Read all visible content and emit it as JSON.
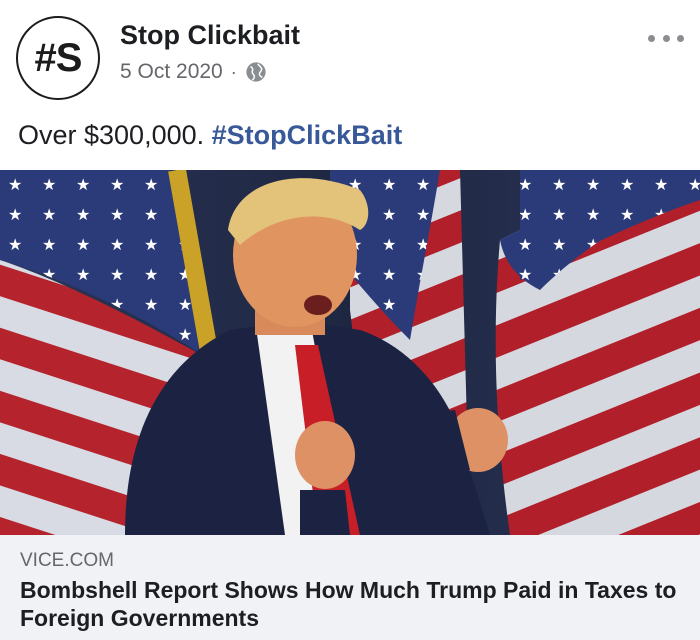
{
  "post": {
    "page_name": "Stop Clickbait",
    "avatar_text": "#S",
    "date": "5 Oct 2020",
    "separator": "·",
    "privacy_icon": "globe-icon",
    "more_icon": "more-options-icon",
    "text_prefix": "Over $300,000.",
    "hashtag": "#StopClickBait"
  },
  "link_preview": {
    "domain": "VICE.COM",
    "headline": "Bombshell Report Shows How Much Trump Paid in Taxes to Foreign Governments"
  },
  "colors": {
    "hashtag": "#385898",
    "card_bg": "#f0f2f5",
    "meta_text": "#65676b"
  }
}
